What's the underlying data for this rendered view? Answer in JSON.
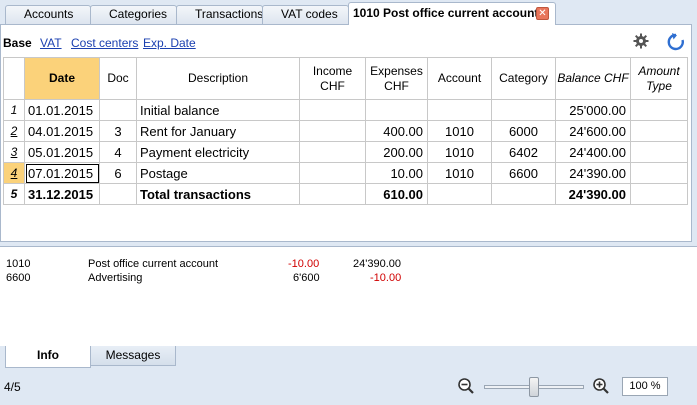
{
  "tabs": [
    {
      "label": "Accounts",
      "active": false
    },
    {
      "label": "Categories",
      "active": false
    },
    {
      "label": "Transactions",
      "active": false
    },
    {
      "label": "VAT codes",
      "active": false
    },
    {
      "label": "1010 Post office current account",
      "active": true
    }
  ],
  "views": [
    {
      "label": "Base",
      "active": true
    },
    {
      "label": "VAT",
      "active": false
    },
    {
      "label": "Cost centers",
      "active": false
    },
    {
      "label": "Exp. Date",
      "active": false
    }
  ],
  "icons": {
    "settings": "gear-icon",
    "refresh": "refresh-icon",
    "close": "close-icon"
  },
  "table": {
    "headers": {
      "date": "Date",
      "doc": "Doc",
      "description": "Description",
      "income": "Income\nCHF",
      "expenses": "Expenses\nCHF",
      "account": "Account",
      "category": "Category",
      "balance": "Balance CHF",
      "amount_type": "Amount\nType"
    },
    "rows": [
      {
        "num": "1",
        "date": "01.01.2015",
        "doc": "",
        "description": "Initial balance",
        "income": "",
        "expenses": "",
        "account": "",
        "category": "",
        "balance": "25'000.00",
        "amount_type": ""
      },
      {
        "num": "2",
        "date": "04.01.2015",
        "doc": "3",
        "description": "Rent for January",
        "income": "",
        "expenses": "400.00",
        "account": "1010",
        "category": "6000",
        "balance": "24'600.00",
        "amount_type": ""
      },
      {
        "num": "3",
        "date": "05.01.2015",
        "doc": "4",
        "description": "Payment electricity",
        "income": "",
        "expenses": "200.00",
        "account": "1010",
        "category": "6402",
        "balance": "24'400.00",
        "amount_type": ""
      },
      {
        "num": "4",
        "date": "07.01.2015",
        "doc": "6",
        "description": "Postage",
        "income": "",
        "expenses": "10.00",
        "account": "1010",
        "category": "6600",
        "balance": "24'390.00",
        "amount_type": ""
      },
      {
        "num": "5",
        "date": "31.12.2015",
        "doc": "",
        "description": "Total transactions",
        "income": "",
        "expenses": "610.00",
        "account": "",
        "category": "",
        "balance": "24'390.00",
        "amount_type": ""
      }
    ]
  },
  "info_lines": [
    {
      "account": "1010",
      "name": "Post office current account",
      "change": "-10.00",
      "balance": "24'390.00",
      "extra": ""
    },
    {
      "account": "6600",
      "name": "Advertising",
      "change": "",
      "balance": "6'600",
      "extra": "-10.00"
    }
  ],
  "bottom_tabs": [
    {
      "label": "Info",
      "active": true
    },
    {
      "label": "Messages",
      "active": false
    }
  ],
  "status": {
    "position": "4/5",
    "zoom": "100 %",
    "zoom_level": 0.45
  },
  "colors": {
    "accent": "#fbd27a",
    "negative": "#d00000",
    "link": "#1a3fb0",
    "refresh": "#2f6fd1",
    "arrow": "#e0245a"
  }
}
